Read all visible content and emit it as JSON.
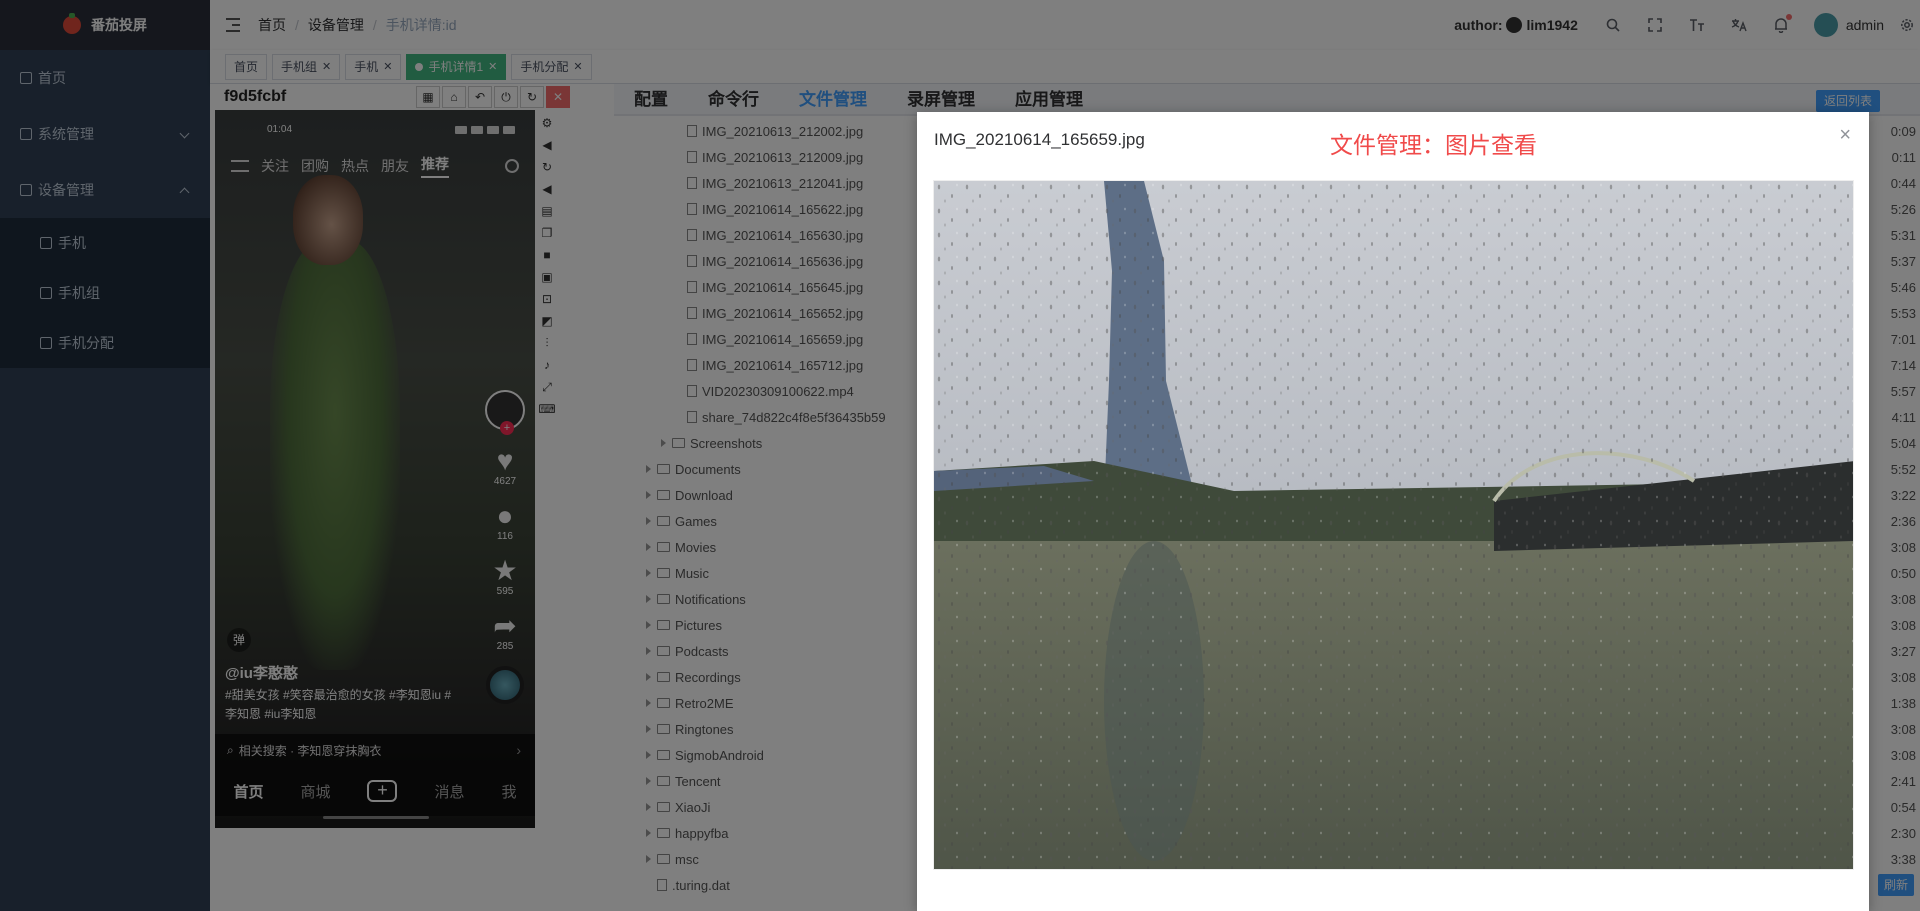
{
  "app": {
    "logo_text": "番茄投屏"
  },
  "sidebar": {
    "items": [
      {
        "label": "首页",
        "icon": "home-icon"
      },
      {
        "label": "系统管理",
        "icon": "monitor-icon"
      },
      {
        "label": "设备管理",
        "icon": "device-icon"
      }
    ],
    "sub_items": [
      {
        "label": "手机",
        "icon": "phone-icon"
      },
      {
        "label": "手机组",
        "icon": "phone-group-icon"
      },
      {
        "label": "手机分配",
        "icon": "folder-icon"
      }
    ]
  },
  "navbar": {
    "breadcrumb": [
      "首页",
      "设备管理",
      "手机详情:id"
    ],
    "author_label": "author:",
    "author_name": "lim1942",
    "user": "admin"
  },
  "tags": [
    {
      "label": "首页",
      "closable": false,
      "active": false
    },
    {
      "label": "手机组",
      "closable": true,
      "active": false
    },
    {
      "label": "手机",
      "closable": true,
      "active": false
    },
    {
      "label": "手机详情1",
      "closable": true,
      "active": true
    },
    {
      "label": "手机分配",
      "closable": true,
      "active": false
    }
  ],
  "device": {
    "id": "f9d5fcbf",
    "phone": {
      "time": "01:04",
      "tabs": [
        "关注",
        "团购",
        "热点",
        "朋友",
        "推荐"
      ],
      "rail": {
        "likes": "4627",
        "comments": "116",
        "favorites": "595",
        "shares": "285"
      },
      "yin": "弹",
      "author": "@iu李憨憨",
      "caption": "#甜美女孩 #笑容最治愈的女孩 #李知恩iu #李知恩 #iu李知恩",
      "related": "相关搜索 · 李知恩穿抹胸衣",
      "bottom_nav": [
        "首页",
        "商城",
        "+",
        "消息",
        "我"
      ]
    }
  },
  "file_panel": {
    "tabs": [
      "配置",
      "命令行",
      "文件管理",
      "录屏管理",
      "应用管理"
    ],
    "back_button": "返回列表",
    "refresh_button": "刷新",
    "files": [
      {
        "name": "IMG_20210613_212002.jpg",
        "type": "file",
        "time": "0:09"
      },
      {
        "name": "IMG_20210613_212009.jpg",
        "type": "file",
        "time": "0:11"
      },
      {
        "name": "IMG_20210613_212041.jpg",
        "type": "file",
        "time": "0:44"
      },
      {
        "name": "IMG_20210614_165622.jpg",
        "type": "file",
        "time": "5:26"
      },
      {
        "name": "IMG_20210614_165630.jpg",
        "type": "file",
        "time": "5:31"
      },
      {
        "name": "IMG_20210614_165636.jpg",
        "type": "file",
        "time": "5:37"
      },
      {
        "name": "IMG_20210614_165645.jpg",
        "type": "file",
        "time": "5:46"
      },
      {
        "name": "IMG_20210614_165652.jpg",
        "type": "file",
        "time": "5:53"
      },
      {
        "name": "IMG_20210614_165659.jpg",
        "type": "file",
        "time": "7:01"
      },
      {
        "name": "IMG_20210614_165712.jpg",
        "type": "file",
        "time": "7:14"
      },
      {
        "name": "VID20230309100622.mp4",
        "type": "file",
        "time": "5:57"
      },
      {
        "name": "share_74d822c4f8e5f36435b59",
        "type": "file",
        "time": "4:11"
      },
      {
        "name": "Screenshots",
        "type": "dir",
        "level": 2,
        "time": "5:04"
      },
      {
        "name": "Documents",
        "type": "dir",
        "time": "5:52"
      },
      {
        "name": "Download",
        "type": "dir",
        "time": "3:22"
      },
      {
        "name": "Games",
        "type": "dir",
        "time": "2:36"
      },
      {
        "name": "Movies",
        "type": "dir",
        "time": "3:08"
      },
      {
        "name": "Music",
        "type": "dir",
        "time": "0:50"
      },
      {
        "name": "Notifications",
        "type": "dir",
        "time": "3:08"
      },
      {
        "name": "Pictures",
        "type": "dir",
        "time": "3:08"
      },
      {
        "name": "Podcasts",
        "type": "dir",
        "time": "3:27"
      },
      {
        "name": "Recordings",
        "type": "dir",
        "time": "3:08"
      },
      {
        "name": "Retro2ME",
        "type": "dir",
        "time": "1:38"
      },
      {
        "name": "Ringtones",
        "type": "dir",
        "time": "3:08"
      },
      {
        "name": "SigmobAndroid",
        "type": "dir",
        "time": "3:08"
      },
      {
        "name": "Tencent",
        "type": "dir",
        "time": "2:41"
      },
      {
        "name": "XiaoJi",
        "type": "dir",
        "time": "0:54"
      },
      {
        "name": "happyfba",
        "type": "dir",
        "time": "2:30"
      },
      {
        "name": "msc",
        "type": "dir",
        "time": "3:38"
      },
      {
        "name": ".turing.dat",
        "type": "file",
        "level": 1,
        "time": ""
      }
    ]
  },
  "modal": {
    "filename": "IMG_20210614_165659.jpg",
    "heading": "文件管理：图片查看",
    "close": "×"
  },
  "colors": {
    "sidebar_bg": "#304156",
    "primary": "#409eff",
    "active_tag": "#42b983",
    "heading_red": "#f04a4a"
  }
}
